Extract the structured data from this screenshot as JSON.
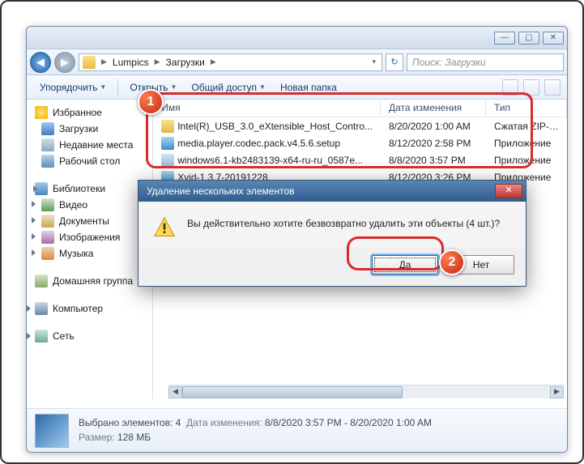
{
  "breadcrumb": {
    "parts": [
      "Lumpics",
      "Загрузки"
    ]
  },
  "search": {
    "placeholder": "Поиск: Загрузки"
  },
  "toolbar": {
    "organize": "Упорядочить",
    "open": "Открыть",
    "share": "Общий доступ",
    "newfolder": "Новая папка"
  },
  "sidebar": {
    "favorites": "Избранное",
    "fav_items": [
      "Загрузки",
      "Недавние места",
      "Рабочий стол"
    ],
    "libraries": "Библиотеки",
    "lib_items": [
      "Видео",
      "Документы",
      "Изображения",
      "Музыка"
    ],
    "homegroup": "Домашняя группа",
    "computer": "Компьютер",
    "network": "Сеть"
  },
  "columns": {
    "name": "Имя",
    "date": "Дата изменения",
    "type": "Тип"
  },
  "files": [
    {
      "name": "Intel(R)_USB_3.0_eXtensible_Host_Contro...",
      "date": "8/20/2020 1:00 AM",
      "type": "Сжатая ZIP-па",
      "icon": "zip"
    },
    {
      "name": "media.player.codec.pack.v4.5.6.setup",
      "date": "8/12/2020 2:58 PM",
      "type": "Приложение",
      "icon": "app"
    },
    {
      "name": "windows6.1-kb2483139-x64-ru-ru_0587e...",
      "date": "8/8/2020 3:57 PM",
      "type": "Приложение",
      "icon": "upd"
    },
    {
      "name": "Xvid-1.3.7-20191228",
      "date": "8/12/2020 3:26 PM",
      "type": "Приложение",
      "icon": "app"
    }
  ],
  "dialog": {
    "title": "Удаление нескольких элементов",
    "message": "Вы действительно хотите безвозвратно удалить эти объекты (4 шт.)?",
    "yes": "Да",
    "no": "Нет"
  },
  "status": {
    "selected": "Выбрано элементов: 4",
    "date_label": "Дата изменения:",
    "date_value": "8/8/2020 3:57 PM - 8/20/2020 1:00 AM",
    "size_label": "Размер:",
    "size_value": "128 МБ"
  },
  "callouts": {
    "one": "1",
    "two": "2"
  }
}
